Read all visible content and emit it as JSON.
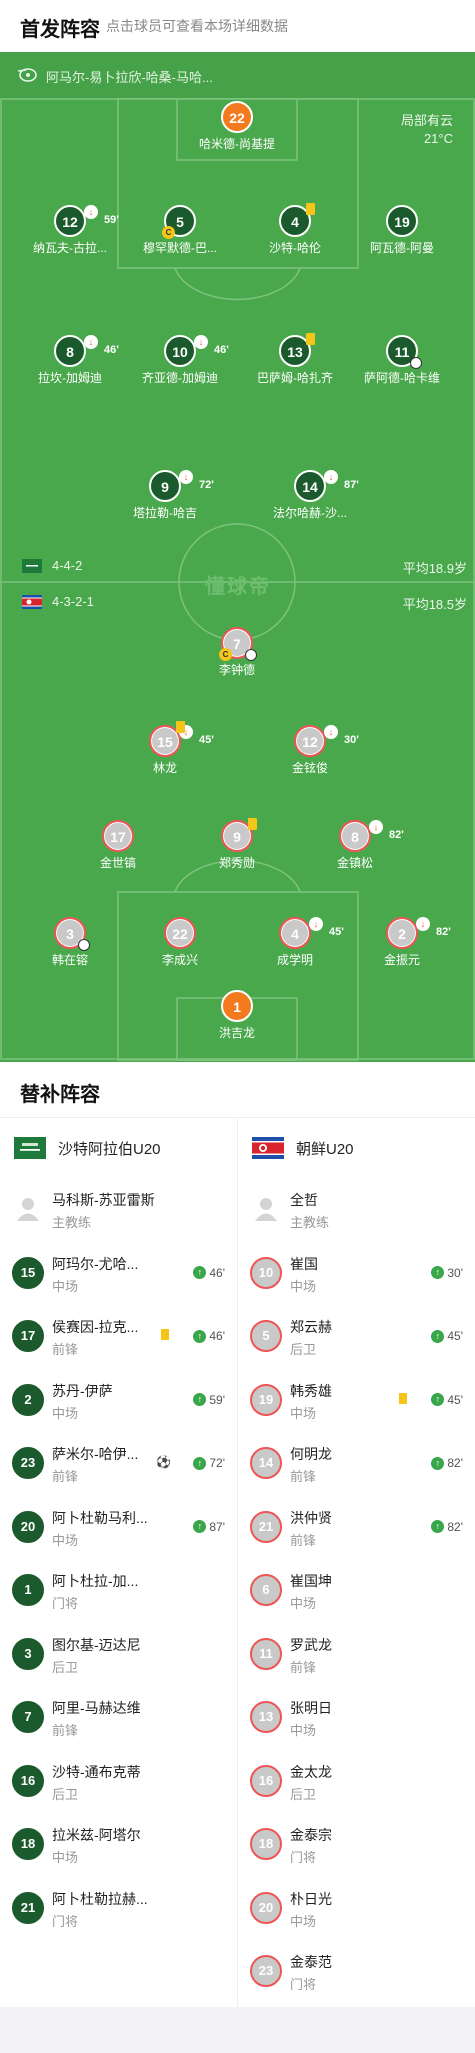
{
  "header": {
    "title": "首发阵容",
    "subtitle": "点击球员可查看本场详细数据"
  },
  "referee": {
    "icon": "whistle-icon",
    "name": "阿马尔-易卜拉欣-哈桑-马哈..."
  },
  "weather": {
    "condition": "局部有云",
    "temperature": "21°C"
  },
  "watermark": "懂球帝",
  "home_team": {
    "formation": "4-4-2",
    "avg_age": "平均18.9岁",
    "flag": "saudi-flag-icon"
  },
  "away_team": {
    "formation": "4-3-2-1",
    "avg_age": "平均18.5岁",
    "flag": "north-korea-flag-icon"
  },
  "home_starters": [
    {
      "no": "22",
      "name": "哈米德-尚基提",
      "gk": true
    },
    {
      "no": "12",
      "name": "纳瓦夫-古拉...",
      "sub": "59'"
    },
    {
      "no": "5",
      "name": "穆罕默德-巴...",
      "captain": "C"
    },
    {
      "no": "4",
      "name": "沙特-哈伦",
      "yellow": true
    },
    {
      "no": "19",
      "name": "阿瓦德-阿曼"
    },
    {
      "no": "8",
      "name": "拉坎-加姆迪",
      "sub": "46'"
    },
    {
      "no": "10",
      "name": "齐亚德-加姆迪",
      "sub": "46'"
    },
    {
      "no": "13",
      "name": "巴萨姆-哈扎齐",
      "yellow": true
    },
    {
      "no": "11",
      "name": "萨阿德-哈卡维",
      "goal": true
    },
    {
      "no": "9",
      "name": "塔拉勒-哈吉",
      "sub": "72'"
    },
    {
      "no": "14",
      "name": "法尔哈赫-沙...",
      "sub": "87'"
    }
  ],
  "away_starters": [
    {
      "no": "7",
      "name": "李钟德",
      "captain": "C",
      "goal": true
    },
    {
      "no": "15",
      "name": "林龙",
      "yellow": true,
      "sub": "45'"
    },
    {
      "no": "12",
      "name": "金铉俊",
      "sub": "30'"
    },
    {
      "no": "17",
      "name": "金世镐"
    },
    {
      "no": "9",
      "name": "郑秀勋",
      "yellow": true
    },
    {
      "no": "8",
      "name": "金镇松",
      "sub": "82'"
    },
    {
      "no": "3",
      "name": "韩在镕",
      "goal": true
    },
    {
      "no": "22",
      "name": "李成兴"
    },
    {
      "no": "4",
      "name": "成学明",
      "sub": "45'"
    },
    {
      "no": "2",
      "name": "金振元",
      "sub": "82'"
    },
    {
      "no": "1",
      "name": "洪吉龙",
      "gk": true
    }
  ],
  "subs": {
    "title": "替补阵容",
    "home_name": "沙特阿拉伯U20",
    "away_name": "朝鲜U20",
    "home_coach": {
      "name": "马科斯-苏亚雷斯",
      "role": "主教练"
    },
    "away_coach": {
      "name": "全哲",
      "role": "主教练"
    },
    "home": [
      {
        "no": "15",
        "name": "阿玛尔-尤哈...",
        "pos": "中场",
        "in": "46'"
      },
      {
        "no": "17",
        "name": "侯赛因-拉克...",
        "pos": "前锋",
        "in": "46'",
        "yellow": true
      },
      {
        "no": "2",
        "name": "苏丹-伊萨",
        "pos": "中场",
        "in": "59'"
      },
      {
        "no": "23",
        "name": "萨米尔-哈伊...",
        "pos": "前锋",
        "in": "72'",
        "goal": true
      },
      {
        "no": "20",
        "name": "阿卜杜勒马利...",
        "pos": "中场",
        "in": "87'"
      },
      {
        "no": "1",
        "name": "阿卜杜拉-加...",
        "pos": "门将"
      },
      {
        "no": "3",
        "name": "图尔基-迈达尼",
        "pos": "后卫"
      },
      {
        "no": "7",
        "name": "阿里-马赫达维",
        "pos": "前锋"
      },
      {
        "no": "16",
        "name": "沙特-通布克蒂",
        "pos": "后卫"
      },
      {
        "no": "18",
        "name": "拉米兹-阿塔尔",
        "pos": "中场"
      },
      {
        "no": "21",
        "name": "阿卜杜勒拉赫...",
        "pos": "门将"
      }
    ],
    "away": [
      {
        "no": "10",
        "name": "崔国",
        "pos": "中场",
        "in": "30'"
      },
      {
        "no": "5",
        "name": "郑云赫",
        "pos": "后卫",
        "in": "45'"
      },
      {
        "no": "19",
        "name": "韩秀雄",
        "pos": "中场",
        "in": "45'",
        "yellow": true
      },
      {
        "no": "14",
        "name": "何明龙",
        "pos": "前锋",
        "in": "82'"
      },
      {
        "no": "21",
        "name": "洪仲贤",
        "pos": "前锋",
        "in": "82'"
      },
      {
        "no": "6",
        "name": "崔国坤",
        "pos": "中场"
      },
      {
        "no": "11",
        "name": "罗武龙",
        "pos": "前锋"
      },
      {
        "no": "13",
        "name": "张明日",
        "pos": "中场"
      },
      {
        "no": "16",
        "name": "金太龙",
        "pos": "后卫"
      },
      {
        "no": "18",
        "name": "金泰宗",
        "pos": "门将"
      },
      {
        "no": "20",
        "name": "朴日光",
        "pos": "中场"
      },
      {
        "no": "23",
        "name": "金泰范",
        "pos": "门将"
      }
    ]
  }
}
